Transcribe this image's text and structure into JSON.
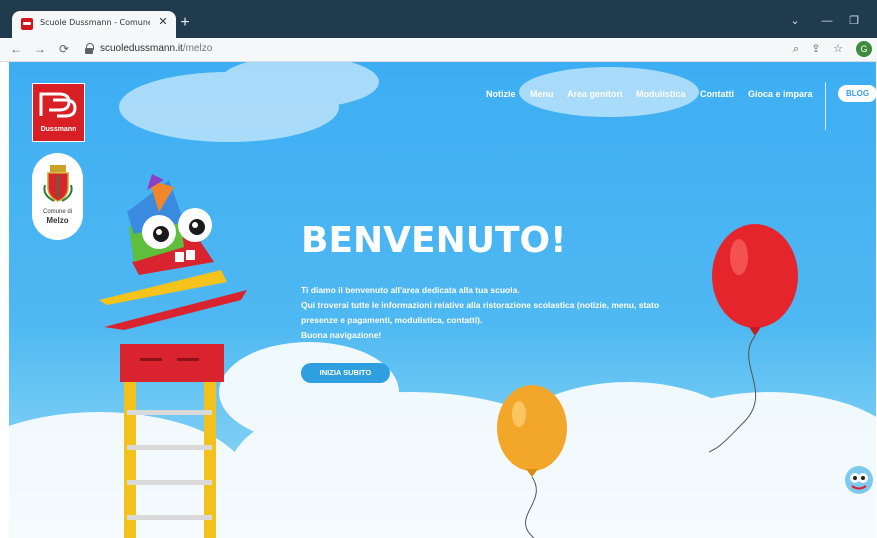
{
  "browser": {
    "tab_title": "Scuole Dussmann - Comune di Melzo",
    "tab_close": "✕",
    "new_tab": "+",
    "url_host": "scuoledussmann.it",
    "url_path": "/melzo",
    "avatar_initial": "G",
    "icons": [
      "back-arrow-icon",
      "forward-arrow-icon",
      "reload-icon",
      "lock-icon",
      "zoom-icon",
      "share-icon",
      "star-icon"
    ]
  },
  "site": {
    "brand_name": "Dussmann",
    "comune_label": "Comune di",
    "comune_name": "Melzo",
    "nav": [
      "Notizie",
      "Menu",
      "Area genitori",
      "Modulistica",
      "Contatti",
      "Gioca e impara"
    ],
    "blog_label": "BLOG",
    "hero_title": "BENVENUTO!",
    "hero_lines": [
      "Ti diamo il benvenuto all'area dedicata alla tua scuola.",
      "Qui troverai tutte le informazioni relative alla ristorazione scolastica (notizie, menu, stato",
      "presenze e pagamenti, modulistica, contatti).",
      "Buona navigazione!"
    ],
    "cta_label": "INIZIA SUBITO",
    "colors": {
      "brand_red": "#d81f26",
      "sky": "#3daef3",
      "cta": "#2f9fe0"
    }
  }
}
